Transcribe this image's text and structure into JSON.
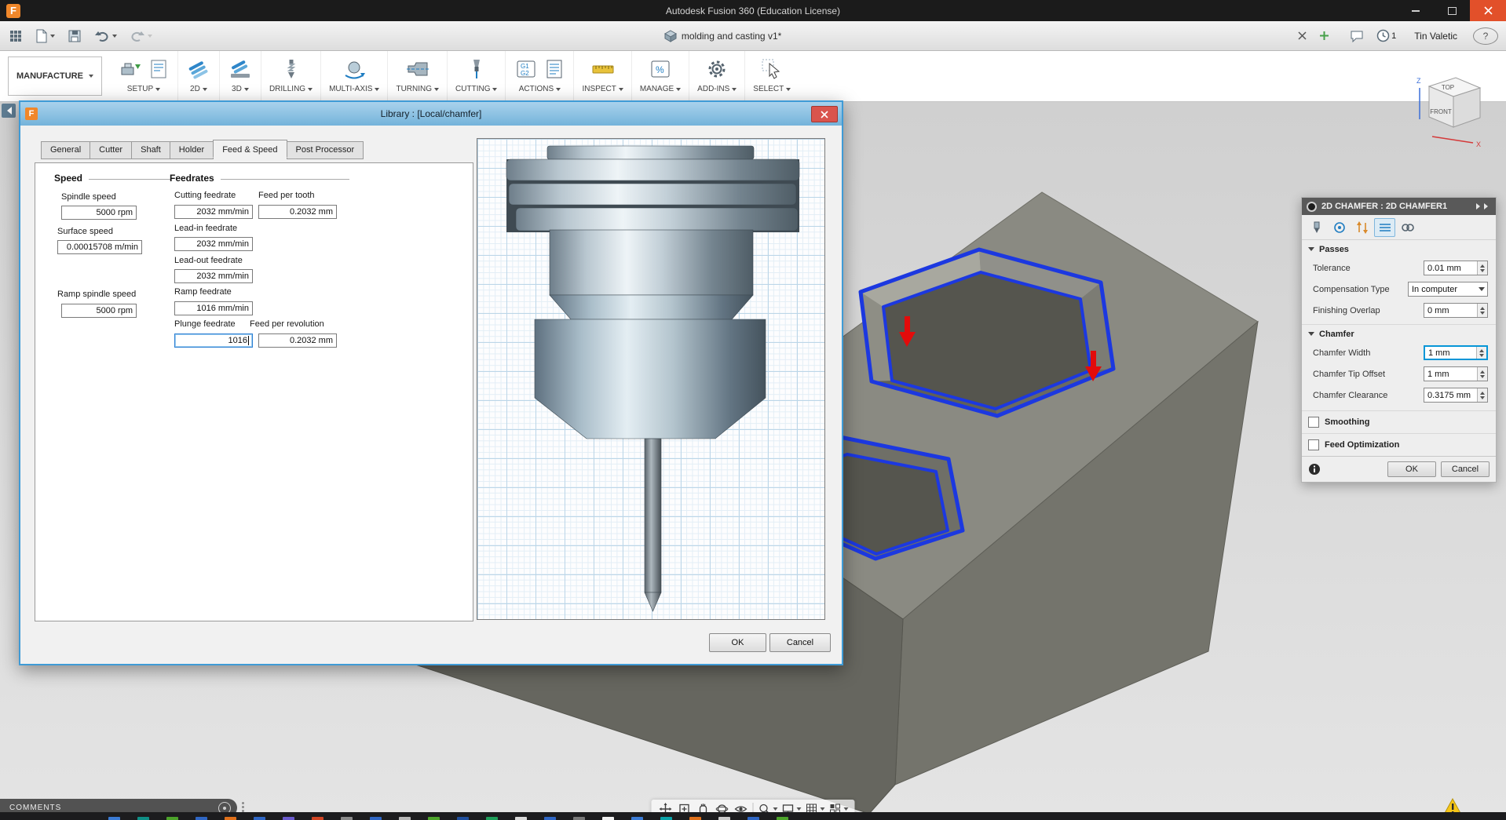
{
  "titlebar": {
    "logo": "F",
    "title": "Autodesk Fusion 360 (Education License)"
  },
  "quickbar": {
    "doc_title": "molding and casting v1*",
    "notif_count": "1",
    "user": "Tin Valetic",
    "help_glyph": "?"
  },
  "ribbon": {
    "workspace": "MANUFACTURE",
    "groups": [
      {
        "label": "SETUP"
      },
      {
        "label": "2D"
      },
      {
        "label": "3D"
      },
      {
        "label": "DRILLING"
      },
      {
        "label": "MULTI-AXIS"
      },
      {
        "label": "TURNING"
      },
      {
        "label": "CUTTING"
      },
      {
        "label": "ACTIONS"
      },
      {
        "label": "INSPECT"
      },
      {
        "label": "MANAGE"
      },
      {
        "label": "ADD-INS"
      },
      {
        "label": "SELECT"
      }
    ],
    "icon_glyphs": {
      "g1": "G1",
      "g2": "G2",
      "percent": "%"
    }
  },
  "viewcube": {
    "top": "TOP",
    "front": "FRONT",
    "axis_x": "X",
    "axis_z": "Z"
  },
  "library_dialog": {
    "title": "Library : [Local/chamfer]",
    "tabs": [
      {
        "label": "General"
      },
      {
        "label": "Cutter"
      },
      {
        "label": "Shaft"
      },
      {
        "label": "Holder"
      },
      {
        "label": "Feed & Speed"
      },
      {
        "label": "Post Processor"
      }
    ],
    "speed": {
      "heading": "Speed",
      "spindle": {
        "label": "Spindle speed",
        "value": "5000 rpm"
      },
      "surface": {
        "label": "Surface speed",
        "value": "0.00015708 m/min"
      },
      "ramp": {
        "label": "Ramp spindle speed",
        "value": "5000 rpm"
      }
    },
    "feedrates": {
      "heading": "Feedrates",
      "cutting": {
        "label": "Cutting feedrate",
        "value": "2032 mm/min"
      },
      "per_tooth": {
        "label": "Feed per tooth",
        "value": "0.2032 mm"
      },
      "lead_in": {
        "label": "Lead-in feedrate",
        "value": "2032 mm/min"
      },
      "lead_out": {
        "label": "Lead-out feedrate",
        "value": "2032 mm/min"
      },
      "ramp": {
        "label": "Ramp feedrate",
        "value": "1016 mm/min"
      },
      "plunge": {
        "label": "Plunge feedrate",
        "value": "1016"
      },
      "per_rev": {
        "label": "Feed per revolution",
        "value": "0.2032 mm"
      }
    },
    "ok": "OK",
    "cancel": "Cancel"
  },
  "chamfer_panel": {
    "title": "2D CHAMFER : 2D CHAMFER1",
    "passes": {
      "heading": "Passes",
      "tolerance": {
        "label": "Tolerance",
        "value": "0.01 mm"
      },
      "compensation": {
        "label": "Compensation Type",
        "value": "In computer"
      },
      "overlap": {
        "label": "Finishing Overlap",
        "value": "0 mm"
      }
    },
    "chamfer": {
      "heading": "Chamfer",
      "width": {
        "label": "Chamfer Width",
        "value": "1 mm"
      },
      "tip_offset": {
        "label": "Chamfer Tip Offset",
        "value": "1 mm"
      },
      "clearance": {
        "label": "Chamfer Clearance",
        "value": "0.3175 mm"
      }
    },
    "smoothing_label": "Smoothing",
    "feed_opt_label": "Feed Optimization",
    "ok": "OK",
    "cancel": "Cancel"
  },
  "statusbar": {
    "comments": "COMMENTS"
  },
  "colors": {
    "accent_blue": "#0696d7",
    "selection_outline_blue": "#1c38e0",
    "direction_arrow_red": "#e30b0b",
    "close_button_orange": "#e2502a"
  },
  "taskbar": {
    "chips": [
      "#3a7bd5",
      "#0e8f86",
      "#4ca32a",
      "#2f66c4",
      "#e0701a",
      "#2f66c4",
      "#6a5acd",
      "#d04423",
      "#8a8a8a",
      "#2f66c4",
      "#b7b7b7",
      "#4ca32a",
      "#1f4e9c",
      "#1e9e5a",
      "#d8d8d8",
      "#2f66c4",
      "#777777",
      "#f0f0f0",
      "#3a7bd5",
      "#0aa2a8",
      "#e0701a",
      "#cccccc",
      "#2f66c4",
      "#4ca32a"
    ]
  }
}
